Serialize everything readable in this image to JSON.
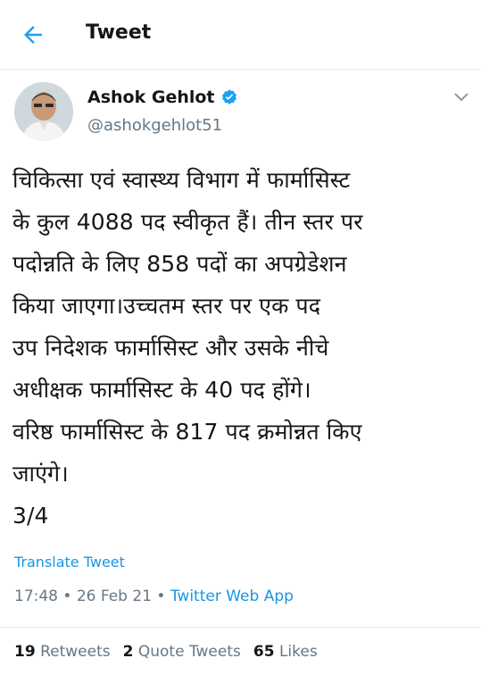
{
  "header": {
    "title": "Tweet"
  },
  "author": {
    "name": "Ashok Gehlot",
    "handle": "@ashokgehlot51"
  },
  "tweet": {
    "text": "चिकित्सा एवं स्वास्थ्य विभाग में फार्मासिस्ट\nके कुल 4088 पद स्वीकृत हैं। तीन स्तर पर\nपदोन्नति के लिए 858 पदों का अपग्रेडेशन\nकिया जाएगा।उच्चतम स्तर पर एक पद\nउप निदेशक फार्मासिस्ट और उसके नीचे\nअधीक्षक फार्मासिस्ट के 40 पद होंगे।\nवरिष्ठ फार्मासिस्ट के 817 पद क्रमोन्नत किए\nजाएंगे।\n3/4",
    "translate_label": "Translate Tweet",
    "time": "17:48",
    "date": "26 Feb 21",
    "source": "Twitter Web App"
  },
  "stats": {
    "retweets_count": "19",
    "retweets_label": "Retweets",
    "quotes_count": "2",
    "quotes_label": "Quote Tweets",
    "likes_count": "65",
    "likes_label": "Likes"
  },
  "colors": {
    "link": "#1b95e0",
    "secondary_text": "#657786",
    "verified": "#1da1f2"
  },
  "icons": [
    "back-arrow-icon",
    "verified-badge-icon",
    "chevron-down-icon"
  ]
}
